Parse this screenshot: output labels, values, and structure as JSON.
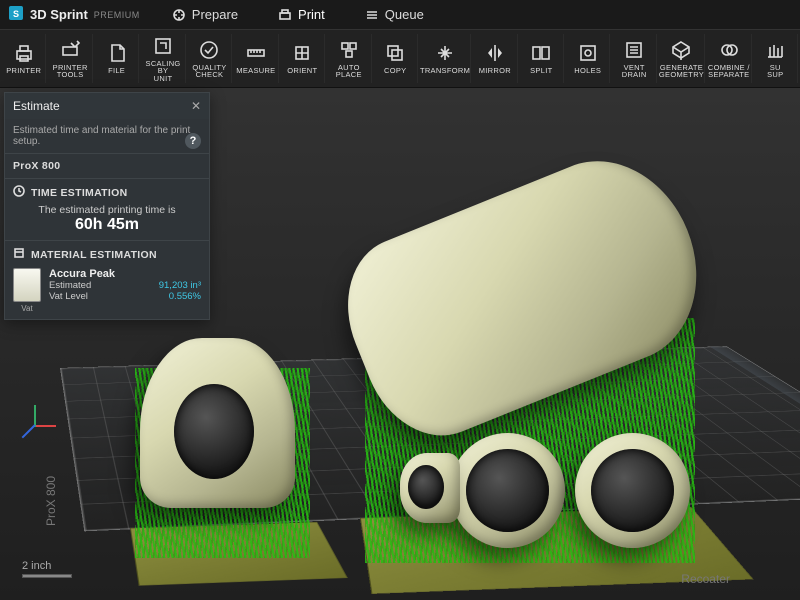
{
  "app": {
    "name": "3D Sprint",
    "edition": "PREMIUM"
  },
  "menu": {
    "prepare": "Prepare",
    "print": "Print",
    "queue": "Queue"
  },
  "toolbar": [
    {
      "id": "printer",
      "label": "PRINTER",
      "icon": "printer-icon"
    },
    {
      "id": "printer-tools",
      "label": "PRINTER\nTOOLS",
      "icon": "wrench-printer-icon"
    },
    {
      "id": "file",
      "label": "FILE",
      "icon": "file-icon"
    },
    {
      "id": "scaling-by-unit",
      "label": "SCALING BY\nUNIT",
      "icon": "scale-icon"
    },
    {
      "id": "quality-check",
      "label": "QUALITY\nCHECK",
      "icon": "check-icon"
    },
    {
      "id": "measure",
      "label": "MEASURE",
      "icon": "ruler-icon"
    },
    {
      "id": "orient",
      "label": "ORIENT",
      "icon": "orient-icon"
    },
    {
      "id": "auto-place",
      "label": "AUTO PLACE",
      "icon": "autoplace-icon"
    },
    {
      "id": "copy",
      "label": "COPY",
      "icon": "copy-icon"
    },
    {
      "id": "transform",
      "label": "TRANSFORM",
      "icon": "transform-icon"
    },
    {
      "id": "mirror",
      "label": "MIRROR",
      "icon": "mirror-icon"
    },
    {
      "id": "split",
      "label": "SPLIT",
      "icon": "split-icon"
    },
    {
      "id": "holes",
      "label": "HOLES",
      "icon": "holes-icon"
    },
    {
      "id": "vent-drain",
      "label": "VENT DRAIN",
      "icon": "vent-icon"
    },
    {
      "id": "generate-geometry",
      "label": "GENERATE\nGEOMETRY",
      "icon": "geometry-icon"
    },
    {
      "id": "combine-separate",
      "label": "COMBINE /\nSEPARATE",
      "icon": "combine-icon"
    },
    {
      "id": "supports",
      "label": "SU\nSUP",
      "icon": "supports-icon"
    }
  ],
  "estimate": {
    "panel_title": "Estimate",
    "description": "Estimated time and material for the print setup.",
    "printer_name": "ProX 800",
    "time_header": "TIME ESTIMATION",
    "time_line": "The estimated printing time is",
    "time_value": "60h  45m",
    "material_header": "MATERIAL ESTIMATION",
    "material_name": "Accura Peak",
    "swatch_label": "Vat",
    "rows": {
      "estimated_label": "Estimated",
      "estimated_value": "91,203 in³",
      "vat_level_label": "Vat Level",
      "vat_level_value": "0.556%"
    }
  },
  "viewport": {
    "scale_label": "2 inch",
    "plate_side_label": "ProX 800",
    "plate_front_label": "Recoater"
  },
  "colors": {
    "accent": "#3fc9e6",
    "support_green": "#2abf14"
  }
}
